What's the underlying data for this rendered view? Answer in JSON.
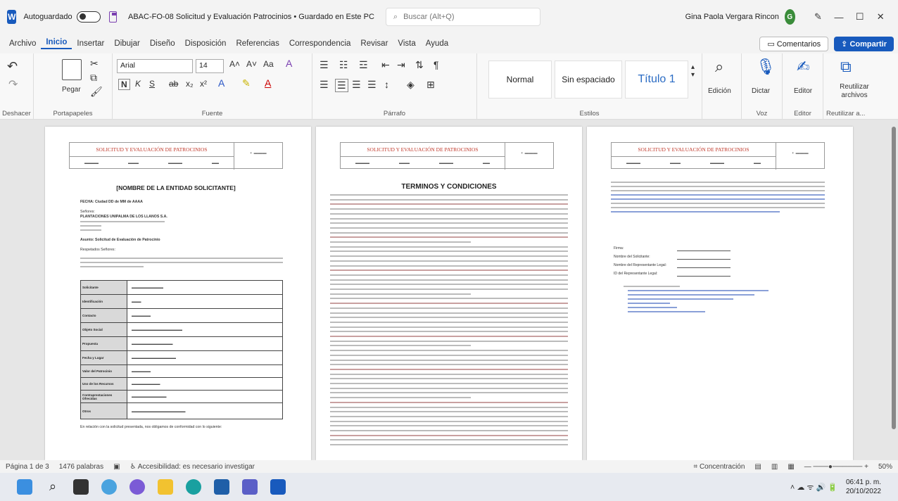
{
  "titlebar": {
    "autosave_label": "Autoguardado",
    "doc_title": "ABAC-FO-08 Solicitud y Evaluación Patrocinios • Guardado en Este PC",
    "search_placeholder": "Buscar (Alt+Q)",
    "user_name": "Gina Paola Vergara Rincon",
    "avatar_initials": "G"
  },
  "menubar": {
    "items": [
      "Archivo",
      "Inicio",
      "Insertar",
      "Dibujar",
      "Diseño",
      "Disposición",
      "Referencias",
      "Correspondencia",
      "Revisar",
      "Vista",
      "Ayuda"
    ],
    "comments_label": "Comentarios",
    "share_label": "Compartir"
  },
  "ribbon": {
    "groups": {
      "undo": "Deshacer",
      "clipboard": "Portapapeles",
      "font": "Fuente",
      "paragraph": "Párrafo",
      "styles": "Estilos",
      "voice": "Voz",
      "editor": "Editor",
      "reuse": "Reutilizar a..."
    },
    "paste_label": "Pegar",
    "font_name": "Arial",
    "font_size": "14",
    "styles": [
      "Normal",
      "Sin espaciado",
      "Título 1"
    ],
    "edit_label": "Edición",
    "dictate_label": "Dictar",
    "editor_label": "Editor",
    "reuse_label": "Reutilizar archivos"
  },
  "page1": {
    "header_title": "SOLICITUD Y EVALUACIÓN DE PATROCINIOS",
    "entity_title": "[NOMBRE DE LA ENTIDAD SOLICITANTE]",
    "fecha": "FECHA: Ciudad DD de MM de AAAA",
    "senores": "Señores:",
    "company": "PLANTACIONES UNIPALMA DE LOS LLANOS S.A.",
    "asunto": "Asunto: Solicitud de Evaluación de Patrocinio",
    "saludo": "Respetados Señores:",
    "table_rows": [
      "Solicitante",
      "Identificación",
      "Contacto",
      "Objeto Social",
      "Propuesta",
      "Fecha y Lugar",
      "Valor del Patrocinio",
      "Uso de los Recursos",
      "Contraprestaciones Ofrecidas",
      "Otros"
    ],
    "closing": "En relación con la solicitud presentada, nos obligamos de conformidad con lo siguiente:"
  },
  "page2": {
    "header_title": "SOLICITUD Y EVALUACIÓN DE PATROCINIOS",
    "terms_title": "TERMINOS Y CONDICIONES"
  },
  "page3": {
    "header_title": "SOLICITUD Y EVALUACIÓN DE PATROCINIOS",
    "signature_fields": [
      "Firma:",
      "Nombre del Solicitante:",
      "Nombre del Representante Legal:",
      "ID del Representante Legal:"
    ]
  },
  "statusbar": {
    "page": "Página 1 de 3",
    "words": "1476 palabras",
    "accessibility": "Accesibilidad: es necesario investigar",
    "focus": "Concentración",
    "zoom": "50%"
  },
  "taskbar": {
    "time": "06:41 p. m.",
    "date": "20/10/2022"
  }
}
